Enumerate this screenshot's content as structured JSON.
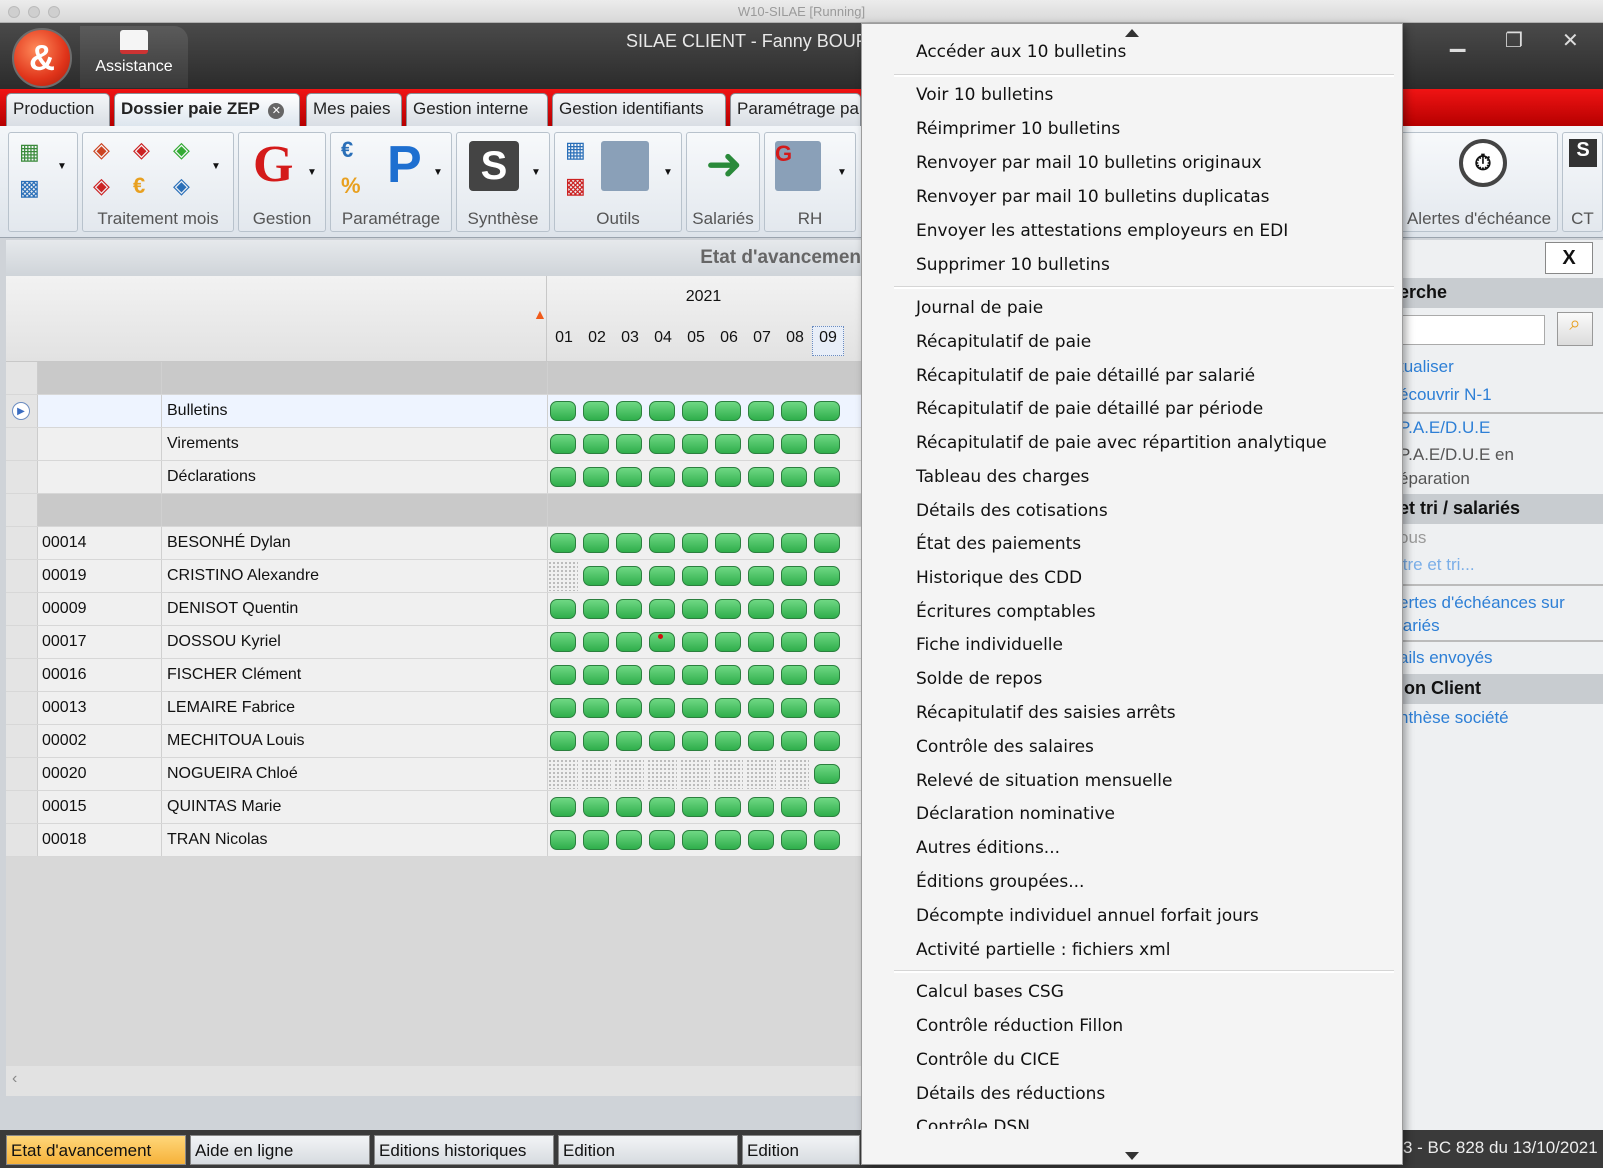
{
  "vm": {
    "title": "W10-SILAE [Running]"
  },
  "app": {
    "title": "SILAE CLIENT - Fanny BOUR",
    "assistance": "Assistance"
  },
  "ribbon_tabs": [
    "Production",
    "Dossier paie ZEP",
    "Mes paies",
    "Gestion interne",
    "Gestion identifiants",
    "Paramétrage pa"
  ],
  "ribbon_groups": {
    "traitement": "Traitement mois",
    "gestion": "Gestion",
    "parametrage": "Paramétrage",
    "synthese": "Synthèse",
    "outils": "Outils",
    "salaries": "Salariés",
    "rh": "RH",
    "alertes": "Alertes d'échéance",
    "ct": "CT"
  },
  "status_header": "Etat d'avancemen",
  "grid": {
    "year": "2021",
    "months": [
      "01",
      "02",
      "03",
      "04",
      "05",
      "06",
      "07",
      "08",
      "09"
    ],
    "summary_rows": [
      {
        "label": "Bulletins",
        "states": [
          "ok",
          "ok",
          "ok",
          "ok",
          "ok",
          "ok",
          "ok",
          "ok",
          "ok"
        ]
      },
      {
        "label": "Virements",
        "states": [
          "ok",
          "ok",
          "ok",
          "ok",
          "ok",
          "ok",
          "ok",
          "ok",
          "ok"
        ]
      },
      {
        "label": "Déclarations",
        "states": [
          "ok",
          "ok",
          "ok",
          "ok",
          "ok",
          "ok",
          "ok",
          "ok",
          "ok"
        ]
      }
    ],
    "employees": [
      {
        "code": "00014",
        "name": "BESONHÉ Dylan",
        "states": [
          "ok",
          "ok",
          "ok",
          "ok",
          "ok",
          "ok",
          "ok",
          "ok",
          "ok"
        ]
      },
      {
        "code": "00019",
        "name": "CRISTINO Alexandre",
        "states": [
          "none",
          "ok",
          "ok",
          "ok",
          "ok",
          "ok",
          "ok",
          "ok",
          "ok"
        ]
      },
      {
        "code": "00009",
        "name": "DENISOT Quentin",
        "states": [
          "ok",
          "ok",
          "ok",
          "ok",
          "ok",
          "ok",
          "ok",
          "ok",
          "ok"
        ]
      },
      {
        "code": "00017",
        "name": "DOSSOU Kyriel",
        "states": [
          "ok",
          "ok",
          "ok",
          "alert",
          "ok",
          "ok",
          "ok",
          "ok",
          "ok"
        ]
      },
      {
        "code": "00016",
        "name": "FISCHER Clément",
        "states": [
          "ok",
          "ok",
          "ok",
          "ok",
          "ok",
          "ok",
          "ok",
          "ok",
          "ok"
        ]
      },
      {
        "code": "00013",
        "name": "LEMAIRE Fabrice",
        "states": [
          "ok",
          "ok",
          "ok",
          "ok",
          "ok",
          "ok",
          "ok",
          "ok",
          "ok"
        ]
      },
      {
        "code": "00002",
        "name": "MECHITOUA Louis",
        "states": [
          "ok",
          "ok",
          "ok",
          "ok",
          "ok",
          "ok",
          "ok",
          "ok",
          "ok"
        ]
      },
      {
        "code": "00020",
        "name": "NOGUEIRA Chloé",
        "states": [
          "none",
          "none",
          "none",
          "none",
          "none",
          "none",
          "none",
          "none",
          "ok"
        ]
      },
      {
        "code": "00015",
        "name": "QUINTAS Marie",
        "states": [
          "ok",
          "ok",
          "ok",
          "ok",
          "ok",
          "ok",
          "ok",
          "ok",
          "ok"
        ]
      },
      {
        "code": "00018",
        "name": "TRAN Nicolas",
        "states": [
          "ok",
          "ok",
          "ok",
          "ok",
          "ok",
          "ok",
          "ok",
          "ok",
          "ok"
        ]
      }
    ]
  },
  "right_panel": {
    "close": "X",
    "search_head": "erche",
    "links1": [
      "tualiser",
      "écouvrir N-1"
    ],
    "pae1": "P.A.E/D.U.E",
    "pae2_l1": "P.A.E/D.U.E en",
    "pae2_l2": "éparation",
    "head2": "et tri / salariés",
    "tous": "ous",
    "filtre": "ltre et tri...",
    "alertes_l1": "ertes d'échéances sur",
    "alertes_l2": "lariés",
    "mails": "ails envoyés",
    "head3": "ion Client",
    "synthese": "nthèse société"
  },
  "bottom_tabs": [
    "Etat d'avancement",
    "Aide en ligne",
    "Editions historiques",
    "Edition",
    "Edition"
  ],
  "version": "3 - BC 828 du 13/10/2021",
  "menu": {
    "groups": [
      [
        "Accéder aux 10 bulletins"
      ],
      [
        "Voir 10 bulletins",
        "Réimprimer 10 bulletins",
        "Renvoyer par mail 10 bulletins originaux",
        "Renvoyer par mail 10 bulletins duplicatas",
        "Envoyer les attestations employeurs en EDI",
        "Supprimer 10 bulletins"
      ],
      [
        "Journal de paie",
        "Récapitulatif de paie",
        "Récapitulatif de paie détaillé par salarié",
        "Récapitulatif de paie détaillé par période",
        "Récapitulatif de paie avec répartition analytique",
        "Tableau des charges",
        "Détails des cotisations",
        "État des paiements",
        "Historique des CDD",
        "Écritures comptables",
        "Fiche individuelle",
        "Solde de repos",
        "Récapitulatif des saisies arrêts",
        "Contrôle des salaires",
        "Relevé de situation mensuelle",
        "Déclaration nominative",
        "Autres éditions...",
        "Éditions groupées...",
        "Décompte individuel annuel forfait jours",
        "Activité partielle : fichiers xml"
      ],
      [
        "Calcul bases CSG",
        "Contrôle réduction Fillon",
        "Contrôle du CICE",
        "Détails des réductions",
        "Contrôle DSN"
      ]
    ]
  }
}
